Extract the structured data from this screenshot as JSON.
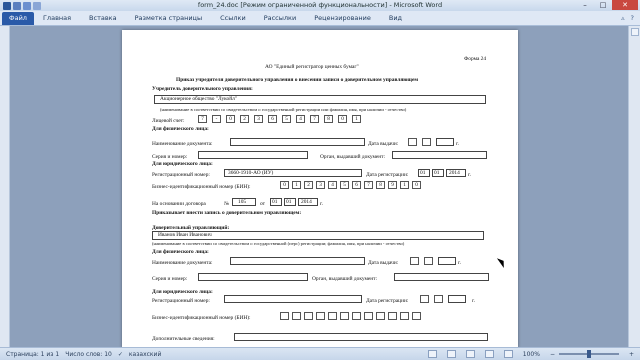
{
  "window": {
    "title": "form_24.doc [Режим ограниченной функциональности] - Microsoft Word"
  },
  "ribbon": {
    "file": "Файл",
    "tabs": [
      "Главная",
      "Вставка",
      "Разметка страницы",
      "Ссылки",
      "Рассылки",
      "Рецензирование",
      "Вид"
    ]
  },
  "doc": {
    "form_no": "Форма 24",
    "org": "АО \"Единый регистратор ценных бумаг\"",
    "heading": "Приказ учредителя доверительного управления о внесении записи о доверительном управляющем",
    "founder_label": "Учредитель доверительного управления:",
    "founder_name": "Акционерное общество \"Лукойл\"",
    "name_hint": "(наименование в соответствии со свидетельством о государственной регистрации или фамилия, имя, при наличии - отчество)",
    "account_label": "Лицевой счет:",
    "account_cells": [
      "7",
      "-",
      "0",
      "2",
      "3",
      "6",
      "5",
      "4",
      "7",
      "8",
      "0",
      "1"
    ],
    "phys1": "Для физического лица:",
    "docname_label": "Наименование документа:",
    "issue_date_label": "Дата выдачи:",
    "series_label": "Серия и номер:",
    "authority_label": "Орган, выдавший документ:",
    "legal1": "Для юридического лица:",
    "regnum_label": "Регистрационный номер:",
    "regnum_value": "3660-1910-АО (ИУ)",
    "regdate_label": "Дата регистрации:",
    "regdate_cells": [
      "01",
      "01",
      "2014"
    ],
    "bin_label": "Бизнес-идентификационный номер (БИН):",
    "bin_cells": [
      "0",
      "1",
      "2",
      "3",
      "4",
      "5",
      "6",
      "7",
      "8",
      "9",
      "1",
      "0"
    ],
    "basis_label": "На основании договора",
    "no_sign": "№",
    "contract_no": "105",
    "from_label": "от",
    "contract_date": [
      "01",
      "01",
      "2014"
    ],
    "year_suffix": "г.",
    "instructs": "Приказывает внести запись о доверительном управляющем:",
    "trustee_label": "Доверительный управляющий:",
    "trustee_name": "Иванов Иван Иванович",
    "name_hint2": "(наименование в соответствии со свидетельством о государственной  (перс) регистрации; фамилия, имя, при наличии - отчество)",
    "phys2": "Для физического лица:",
    "legal2": "Для юридического лица:",
    "bin2_label": "Бизнес-идентификационный номер (БИН):",
    "extra_label": "Дополнительные сведения:"
  },
  "status": {
    "page": "Страница: 1 из 1",
    "words": "Число слов: 10",
    "lang": "казахский",
    "zoom": "100%"
  }
}
